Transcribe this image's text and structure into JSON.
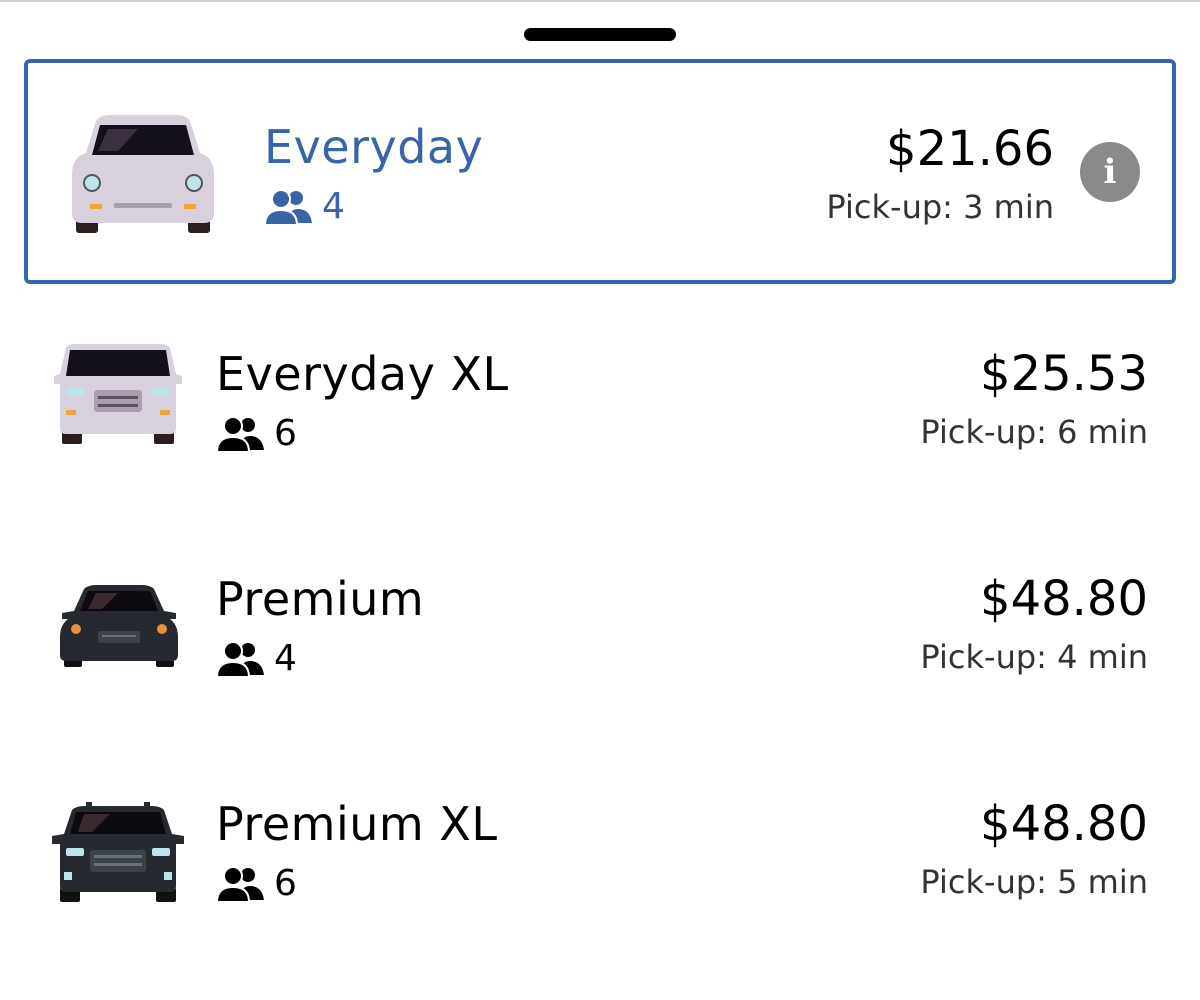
{
  "colors": {
    "accent": "#3a64a8",
    "text": "#000000",
    "muted": "#333333",
    "info": "#8a8a8a"
  },
  "rides": [
    {
      "name": "Everyday",
      "seats": "4",
      "price": "$21.66",
      "pickup": "Pick-up: 3 min",
      "selected": true,
      "car_icon": "car-front-light-icon",
      "info_icon": "i"
    },
    {
      "name": "Everyday XL",
      "seats": "6",
      "price": "$25.53",
      "pickup": "Pick-up: 6 min",
      "selected": false,
      "car_icon": "van-front-light-icon"
    },
    {
      "name": "Premium",
      "seats": "4",
      "price": "$48.80",
      "pickup": "Pick-up: 4 min",
      "selected": false,
      "car_icon": "car-front-dark-icon"
    },
    {
      "name": "Premium XL",
      "seats": "6",
      "price": "$48.80",
      "pickup": "Pick-up: 5 min",
      "selected": false,
      "car_icon": "suv-front-dark-icon"
    }
  ]
}
